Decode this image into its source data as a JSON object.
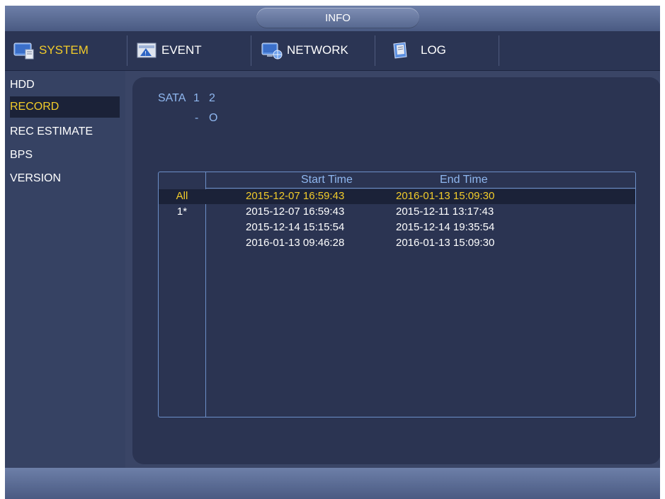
{
  "window": {
    "title": "INFO"
  },
  "tabs": [
    {
      "label": "SYSTEM",
      "icon": "system-icon",
      "active": true
    },
    {
      "label": "EVENT",
      "icon": "event-icon",
      "active": false
    },
    {
      "label": "NETWORK",
      "icon": "network-icon",
      "active": false
    },
    {
      "label": "LOG",
      "icon": "log-icon",
      "active": false
    }
  ],
  "sidebar": {
    "items": [
      {
        "label": "HDD"
      },
      {
        "label": "RECORD",
        "active": true
      },
      {
        "label": "REC ESTIMATE"
      },
      {
        "label": "BPS"
      },
      {
        "label": "VERSION"
      }
    ]
  },
  "sata": {
    "label": "SATA",
    "ports": [
      "1",
      "2"
    ],
    "status": [
      "-",
      "O"
    ]
  },
  "table": {
    "headers": {
      "start": "Start Time",
      "end": "End Time"
    },
    "rows": [
      {
        "index": "All",
        "start": "2015-12-07 16:59:43",
        "end": "2016-01-13 15:09:30",
        "selected": true
      },
      {
        "index": "1*",
        "start": "2015-12-07 16:59:43",
        "end": "2015-12-11 13:17:43"
      },
      {
        "index": "",
        "start": "2015-12-14 15:15:54",
        "end": "2015-12-14 19:35:54"
      },
      {
        "index": "",
        "start": "2016-01-13 09:46:28",
        "end": "2016-01-13 15:09:30"
      }
    ]
  },
  "colors": {
    "accent": "#f2cc2a",
    "panel": "#2b3452",
    "label_blue": "#8fb7ef",
    "border": "#6c8fc8"
  }
}
